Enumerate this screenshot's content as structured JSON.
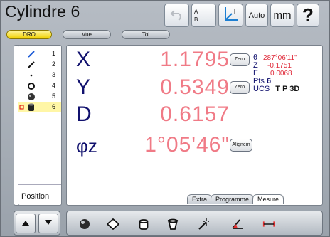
{
  "window": {
    "title": "Cylindre 6"
  },
  "toolbar": {
    "ab_a": "A",
    "ab_b": "B",
    "axes_label": "T",
    "auto_label": "Auto",
    "unit_label": "mm",
    "help_label": "?"
  },
  "top_tabs": [
    {
      "label": "DRO",
      "active": true
    },
    {
      "label": "Vue",
      "active": false
    },
    {
      "label": "Tol",
      "active": false
    }
  ],
  "features": [
    {
      "num": "1",
      "icon": "line-icon",
      "selected": false
    },
    {
      "num": "2",
      "icon": "line-icon",
      "selected": false
    },
    {
      "num": "3",
      "icon": "point-icon",
      "selected": false
    },
    {
      "num": "4",
      "icon": "circle-icon",
      "selected": false
    },
    {
      "num": "5",
      "icon": "sphere-icon",
      "selected": false
    },
    {
      "num": "6",
      "icon": "cylinder-icon",
      "selected": true
    }
  ],
  "left_panel": {
    "position_label": "Position"
  },
  "readouts": [
    {
      "axis": "X",
      "value": "1.1795",
      "button": "Zero"
    },
    {
      "axis": "Y",
      "value": "0.5349",
      "button": "Zero"
    },
    {
      "axis": "D",
      "value": "0.6157",
      "button": ""
    },
    {
      "axis": "φz",
      "value": "1°05'46\"",
      "button": "Alignem"
    }
  ],
  "side_info": {
    "theta_label": "θ",
    "theta_value": "287°06'11\"",
    "z_label": "Z",
    "z_value": "-0.1751",
    "f_label": "F",
    "f_value": "0.0068",
    "pts_label": "Pts",
    "pts_value": "6",
    "ucs_label": "UCS",
    "ucs_flags": "T P 3D"
  },
  "bottom_tabs": [
    {
      "label": "Extra",
      "active": false
    },
    {
      "label": "Programme",
      "active": false
    },
    {
      "label": "Mesure",
      "active": true
    }
  ],
  "bottom_toolbar": [
    "sphere-measure-icon",
    "plane-measure-icon",
    "cylinder-measure-icon",
    "cone-measure-icon",
    "probe-magic-icon",
    "angle-measure-icon",
    "distance-measure-icon"
  ],
  "colors": {
    "accent_value": "#f07a86",
    "axis_label": "#11116e",
    "selection": "#fff6a6",
    "active_tab": "#f0d000"
  }
}
